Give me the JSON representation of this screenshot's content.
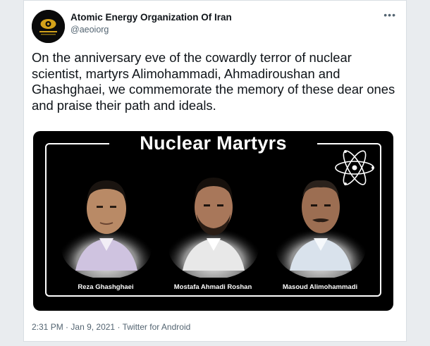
{
  "author": {
    "name": "Atomic Energy Organization Of Iran",
    "handle": "@aeoiorg",
    "avatar_icon": "atom-logo-icon"
  },
  "more_icon": "more-options-icon",
  "tweet": {
    "text": "On the anniversary eve of the cowardly terror of nuclear scientist, martyrs Alimohammadi, Ahmadiroushan and Ghashghaei, we commemorate the memory of these dear ones and praise their path and ideals."
  },
  "media": {
    "title": "Nuclear Martyrs",
    "portraits": [
      {
        "caption": "Reza Ghashghaei"
      },
      {
        "caption": "Mostafa Ahmadi Roshan"
      },
      {
        "caption": "Masoud Alimohammadi"
      }
    ]
  },
  "meta": {
    "time": "2:31 PM",
    "separator": "·",
    "date": "Jan 9, 2021",
    "source": "Twitter for Android"
  },
  "colors": {
    "text": "#0f1419",
    "secondary": "#536471",
    "media_bg": "#000000"
  }
}
